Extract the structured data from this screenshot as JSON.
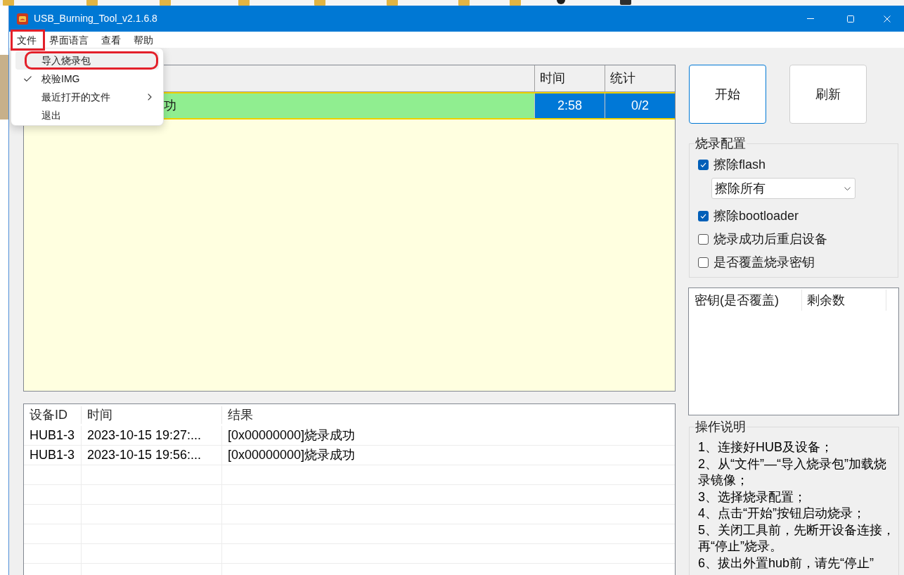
{
  "window": {
    "title": "USB_Burning_Tool_v2.1.6.8"
  },
  "menu_bar": [
    {
      "label": "文件",
      "annotated": true
    },
    {
      "label": "界面语言",
      "annotated": false
    },
    {
      "label": "查看",
      "annotated": false
    },
    {
      "label": "帮助",
      "annotated": false
    }
  ],
  "file_menu": {
    "items": [
      {
        "label": "导入烧录包",
        "hovered": true,
        "checked": false,
        "submenu": false,
        "annotated": true
      },
      {
        "label": "校验IMG",
        "hovered": false,
        "checked": true,
        "submenu": false,
        "annotated": false
      },
      {
        "label": "最近打开的文件",
        "hovered": false,
        "checked": false,
        "submenu": true,
        "annotated": false
      },
      {
        "label": "退出",
        "hovered": false,
        "checked": false,
        "submenu": false,
        "annotated": false
      }
    ]
  },
  "device_table": {
    "columns": [
      "时间",
      "统计"
    ],
    "rows": [
      {
        "color": "#90ee90",
        "status_text": "功",
        "time": "2:58",
        "count": "0/2",
        "selected": true
      }
    ]
  },
  "log_table": {
    "columns": [
      "设备ID",
      "时间",
      "结果"
    ],
    "rows": [
      [
        "HUB1-3",
        "2023-10-15 19:27:...",
        "[0x00000000]烧录成功"
      ],
      [
        "HUB1-3",
        "2023-10-15 19:56:...",
        "[0x00000000]烧录成功"
      ]
    ]
  },
  "actions": [
    {
      "label": "开始",
      "focused": true
    },
    {
      "label": "刷新",
      "focused": false
    }
  ],
  "burn_config": {
    "title": "烧录配置",
    "options": [
      {
        "kind": "checkbox",
        "label": "擦除flash",
        "checked": true
      },
      {
        "kind": "select",
        "value": "擦除所有"
      },
      {
        "kind": "checkbox",
        "label": "擦除bootloader",
        "checked": true
      },
      {
        "kind": "checkbox",
        "label": "烧录成功后重启设备",
        "checked": false
      },
      {
        "kind": "checkbox",
        "label": "是否覆盖烧录密钥",
        "checked": false
      }
    ]
  },
  "key_table": {
    "columns": [
      "密钥(是否覆盖)",
      "剩余数"
    ]
  },
  "instructions": {
    "title": "操作说明",
    "items": [
      "1、连接好HUB及设备；",
      "2、从“文件”—“导入烧录包”加载烧录镜像；",
      "3、选择烧录配置；",
      "4、点击“开始”按钮启动烧录；",
      "5、关闭工具前，先断开设备连接，再“停止”烧录。",
      "6、拔出外置hub前，请先“停止”"
    ]
  }
}
